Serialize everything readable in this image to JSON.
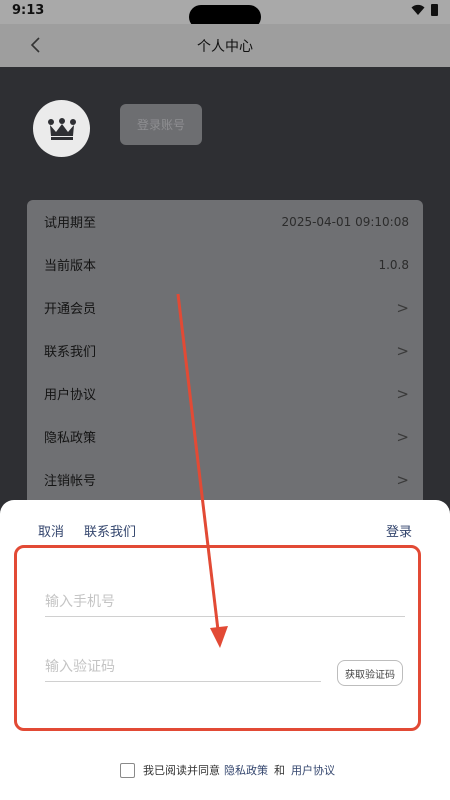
{
  "status_bar": {
    "time": "9:13"
  },
  "header": {
    "title": "个人中心"
  },
  "profile": {
    "login_button": "登录账号"
  },
  "settings": {
    "rows": [
      {
        "label": "试用期至",
        "value": "2025-04-01 09:10:08"
      },
      {
        "label": "当前版本",
        "value": "1.0.8"
      },
      {
        "label": "开通会员",
        "chevron": ">"
      },
      {
        "label": "联系我们",
        "chevron": ">"
      },
      {
        "label": "用户协议",
        "chevron": ">"
      },
      {
        "label": "隐私政策",
        "chevron": ">"
      },
      {
        "label": "注销帐号",
        "chevron": ">"
      }
    ]
  },
  "login_sheet": {
    "cancel": "取消",
    "contact_us": "联系我们",
    "login": "登录",
    "phone_placeholder": "输入手机号",
    "code_placeholder": "输入验证码",
    "get_code": "获取验证码",
    "agree_text": "我已阅读并同意",
    "privacy_policy": "隐私政策",
    "and": "和",
    "user_agreement": "用户协议"
  },
  "colors": {
    "annotation": "#e24a35",
    "link": "#34466e",
    "overlay_dark": "#2e2f33"
  }
}
